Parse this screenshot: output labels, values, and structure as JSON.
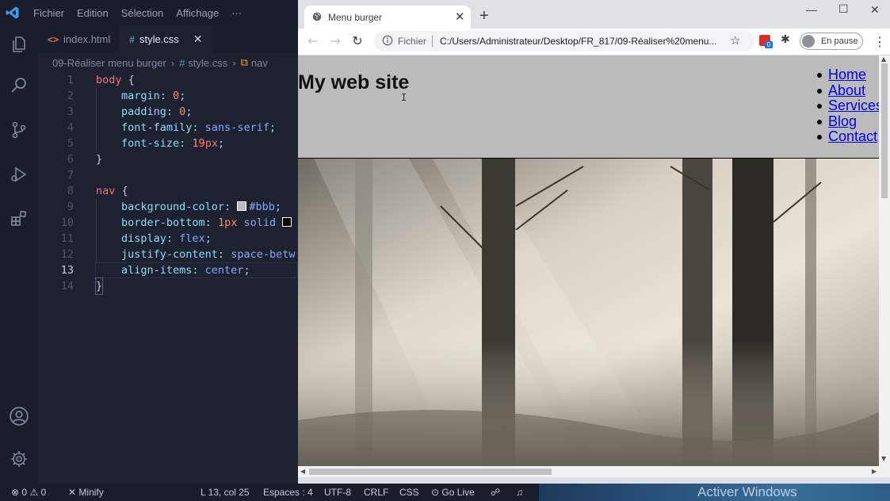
{
  "vscode": {
    "menu": [
      "Fichier",
      "Edition",
      "Sélection",
      "Affichage",
      "···"
    ],
    "tabs": [
      {
        "glyph": "<>",
        "label": "index.html",
        "active": false
      },
      {
        "glyph": "#",
        "label": "style.css",
        "active": true,
        "close": "✕"
      }
    ],
    "breadcrumb": {
      "folder": "09-Réaliser menu burger",
      "file": "style.css",
      "symbol": "nav"
    },
    "current_line": 13,
    "lines": [
      {
        "n": "1"
      },
      {
        "n": "2"
      },
      {
        "n": "3"
      },
      {
        "n": "4"
      },
      {
        "n": "5"
      },
      {
        "n": "6"
      },
      {
        "n": "7"
      },
      {
        "n": "8"
      },
      {
        "n": "9"
      },
      {
        "n": "10"
      },
      {
        "n": "11"
      },
      {
        "n": "12"
      },
      {
        "n": "13"
      },
      {
        "n": "14"
      }
    ],
    "code": {
      "l1_sel": "body",
      "l1_brace": " {",
      "l2_prop": "margin",
      "l2_val": "0",
      "l3_prop": "padding",
      "l3_val": "0",
      "l4_prop": "font-family",
      "l4_val": "sans-serif",
      "l5_prop": "font-size",
      "l5_num": "19",
      "l5_unit": "px",
      "l6": "}",
      "l8_sel": "nav",
      "l8_brace": " {",
      "l9_prop": "background-color",
      "l9_val": "#bbb",
      "l10_prop": "border-bottom",
      "l10_num": "1px",
      "l10_val": "solid",
      "l11_prop": "display",
      "l11_val": "flex",
      "l12_prop": "justify-content",
      "l12_val": "space-betw",
      "l13_prop": "align-items",
      "l13_val": "center",
      "l14": "}"
    }
  },
  "statusbar": {
    "errors": "0",
    "warnings": "0",
    "minify": "Minify",
    "position": "L 13, col 25",
    "spaces": "Espaces : 4",
    "encoding": "UTF-8",
    "eol": "CRLF",
    "language": "CSS",
    "golive": "Go Live",
    "activate": "Activer Windows"
  },
  "chrome": {
    "tab_title": "Menu burger",
    "tab_close": "✕",
    "new_tab": "+",
    "omnibox_label": "Fichier",
    "url": "C:/Users/Administrateur/Desktop/FR_817/09-Réaliser%20menu...",
    "profile_status": "En pause",
    "extension_badge": "0"
  },
  "page": {
    "site_title": "My web site",
    "menu": [
      "Home",
      "About",
      "Services",
      "Blog",
      "Contact"
    ]
  },
  "colors": {
    "nav_background": "#bbbbbb",
    "link": "#0000ee",
    "editor_bg": "#1e2130"
  }
}
